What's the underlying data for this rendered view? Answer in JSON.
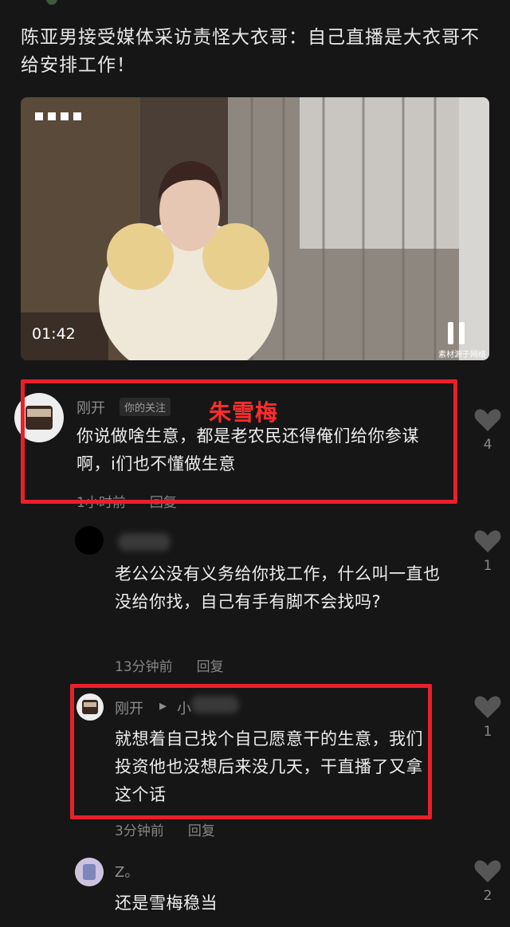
{
  "post": {
    "title": "陈亚男接受媒体采访责怪大衣哥：自己直播是大衣哥不给安排工作！"
  },
  "video": {
    "duration": "01:42",
    "watermark": "素材源于网络"
  },
  "annotation": {
    "label": "朱雪梅"
  },
  "comments": [
    {
      "name": "刚开",
      "tag": "你的关注",
      "text": "你说做啥生意，都是老农民还得俺们给你参谋啊，i们也不懂做生意",
      "time": "1小时前",
      "reply_label": "回复",
      "likes": "4"
    },
    {
      "name": "",
      "text": "老公公没有义务给你找工作，什么叫一直也没给你找，自己有手有脚不会找吗?",
      "time": "13分钟前",
      "reply_label": "回复",
      "likes": "1"
    },
    {
      "name": "刚开",
      "reply_to": "小",
      "text": "就想着自己找个自己愿意干的生意，我们投资他也没想后来没几天，干直播了又拿这个话",
      "time": "3分钟前",
      "reply_label": "回复",
      "likes": "1"
    },
    {
      "name": "Z。",
      "text": "还是雪梅稳当",
      "likes": "2"
    }
  ],
  "colors": {
    "background": "#161616",
    "highlight_box": "#e8202a",
    "annotation": "#ff2d2d"
  }
}
